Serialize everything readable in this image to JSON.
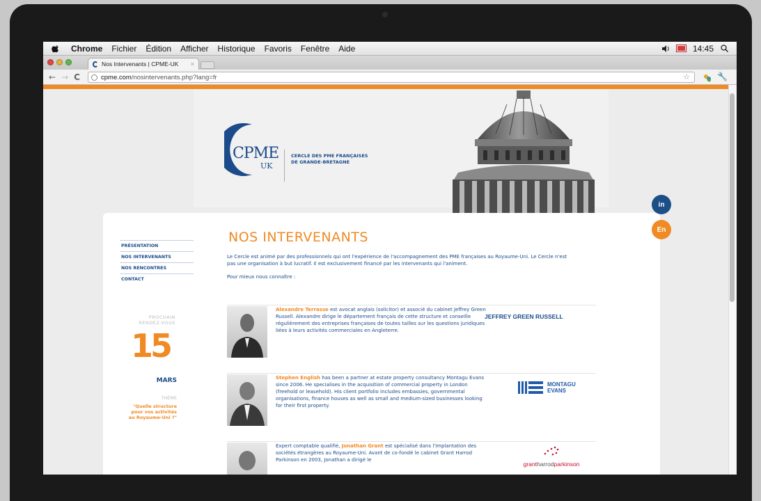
{
  "menubar": {
    "items": [
      "Chrome",
      "Fichier",
      "Édition",
      "Afficher",
      "Historique",
      "Favoris",
      "Fenêtre",
      "Aide"
    ],
    "time": "14:45"
  },
  "browser": {
    "tab_title": "Nos Intervenants | CPME-UK",
    "url_host": "cpme.com",
    "url_path": "/nosintervenants.php?lang=fr"
  },
  "header": {
    "logo_main": "CPME",
    "logo_sub": "UK",
    "tagline_line1": "CERCLE DES PME FRANÇAISES",
    "tagline_line2": "DE GRANDE-BRETAGNE"
  },
  "social": {
    "linkedin": "in",
    "lang": "En"
  },
  "nav": [
    "PRÉSENTATION",
    "NOS INTERVENANTS",
    "NOS RENCONTRES",
    "CONTACT"
  ],
  "event": {
    "label_line1": "PROCHAIN",
    "label_line2": "RENDEZ-VOUS",
    "day": "15",
    "month": "MARS",
    "theme_label": "THÈME",
    "theme_line1": "\"Quelle structure",
    "theme_line2": "pour vos activités",
    "theme_line3": "au Royaume-Uni ?\""
  },
  "main": {
    "title": "NOS INTERVENANTS",
    "intro": "Le Cercle est animé par des professionnels qui ont l'expérience de l'accompagnement des PME françaises au Royaume-Uni. Le Cercle n'est pas une organisation à but lucratif. Il est exclusivement financé par les intervenants qui l'animent.",
    "sub": "Pour mieux nous connaître :"
  },
  "people": [
    {
      "name": "Alexandre Terrasse",
      "text": " est avocat anglais (solicitor) et associé du cabinet Jeffrey Green Russell. Alexandre dirige le département français de cette structure et conseille régulièrement des entreprises françaises de toutes tailles sur les questions juridiques liées à leurs activités commerciales en Angleterre.",
      "brand": "JEFFREY GREEN RUSSELL"
    },
    {
      "name": "Stephen English",
      "text": " has been a partner at estate property consultancy Montagu Evans since 2006. He specialises in the acquisition of commercial property in London (freehold or leasehold). His client portfolio includes embassies, governmental organisations, finance houses as well as small and medium-sized businesses looking for their first property.",
      "brand_line1": "MONTAGU",
      "brand_line2": "EVANS"
    },
    {
      "name_prefix": "Expert comptable qualifié, ",
      "name": "Jonathan Grant",
      "text": " est spécialisé dans l'implantation des sociétés étrangères au Royaume-Uni. Avant de co-fondé le cabinet Grant Harrod Parkinson en 2003, Jonathan a dirigé le",
      "brand_a": "grant",
      "brand_b": "harrod",
      "brand_c": "parkinson"
    }
  ],
  "colors": {
    "orange": "#f08a24",
    "navy": "#1b4b8a"
  }
}
